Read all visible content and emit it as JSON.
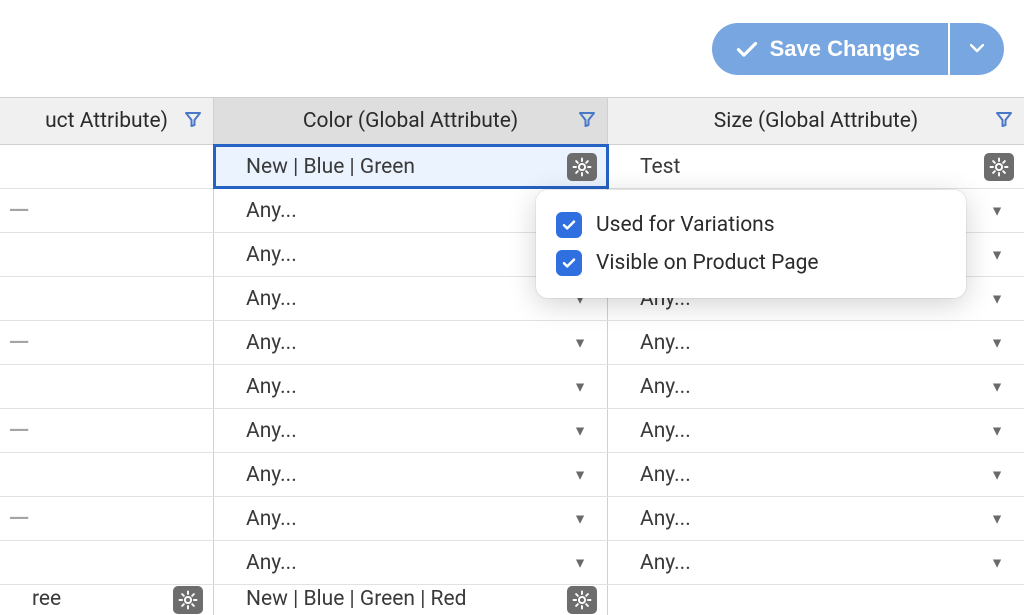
{
  "toolbar": {
    "save_label": "Save Changes"
  },
  "columns": {
    "a": {
      "header": "uct Attribute)"
    },
    "b": {
      "header": "Color (Global Attribute)"
    },
    "c": {
      "header": "Size (Global Attribute)"
    }
  },
  "rows": [
    {
      "a": "",
      "b": "New | Blue | Green",
      "b_selected": true,
      "b_gear": true,
      "c": "Test",
      "c_gear": true
    },
    {
      "a": "—",
      "b": "Any...",
      "c": "Any...",
      "c_dropdown": true
    },
    {
      "a": "",
      "b": "Any...",
      "c": "Any...",
      "c_dropdown": true
    },
    {
      "a": "",
      "b": "Any...",
      "b_dropdown": true,
      "c": "Any...",
      "c_dropdown": true
    },
    {
      "a": "—",
      "b": "Any...",
      "b_dropdown": true,
      "c": "Any...",
      "c_dropdown": true
    },
    {
      "a": "",
      "b": "Any...",
      "b_dropdown": true,
      "c": "Any...",
      "c_dropdown": true
    },
    {
      "a": "—",
      "b": "Any...",
      "b_dropdown": true,
      "c": "Any...",
      "c_dropdown": true
    },
    {
      "a": "",
      "b": "Any...",
      "b_dropdown": true,
      "c": "Any...",
      "c_dropdown": true
    },
    {
      "a": "—",
      "b": "Any...",
      "b_dropdown": true,
      "c": "Any...",
      "c_dropdown": true
    },
    {
      "a": "",
      "b": "Any...",
      "b_dropdown": true,
      "c": "Any...",
      "c_dropdown": true
    },
    {
      "a": "ree",
      "a_gear": true,
      "b": "New | Blue | Green | Red",
      "b_gear": true,
      "c": "",
      "cutoff": true
    }
  ],
  "popover": {
    "opt1": {
      "label": "Used for Variations",
      "checked": true
    },
    "opt2": {
      "label": "Visible on Product Page",
      "checked": true
    }
  }
}
